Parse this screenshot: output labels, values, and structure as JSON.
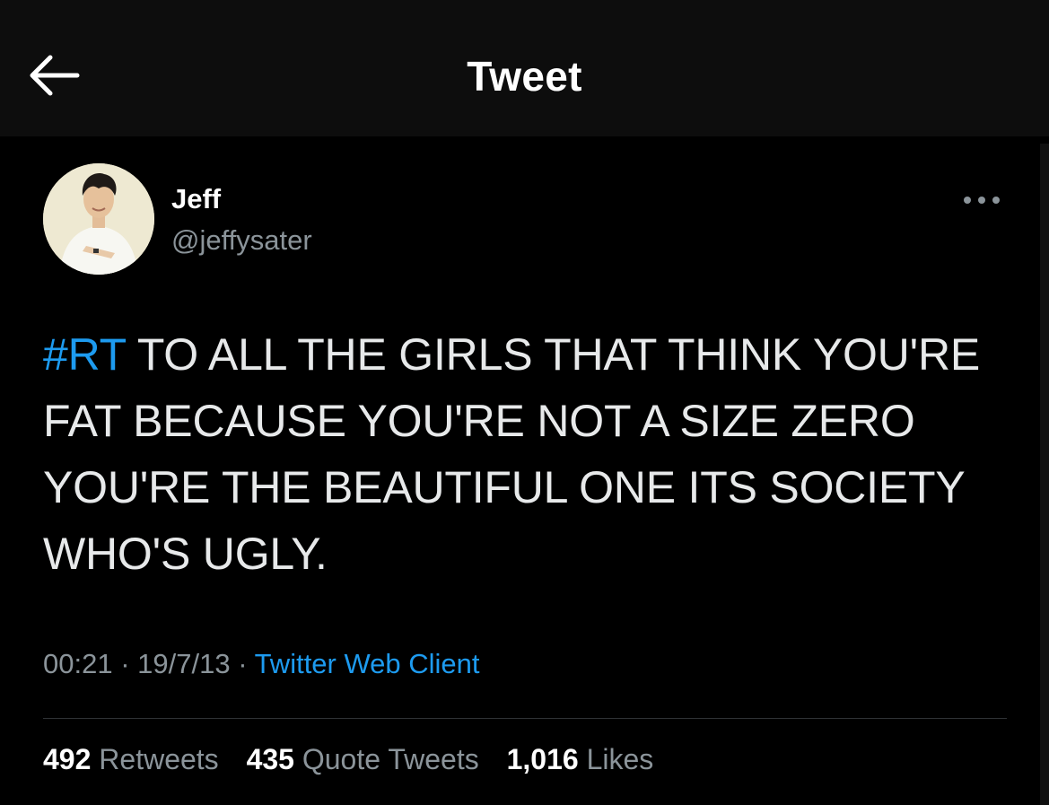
{
  "header": {
    "title": "Tweet",
    "back_icon": "arrow-left-icon"
  },
  "author": {
    "name": "Jeff",
    "handle": "@jeffysater",
    "avatar_icon": "profile-photo"
  },
  "more_icon": "ellipsis-icon",
  "tweet": {
    "hashtag": "#RT",
    "text_after_hashtag": " TO ALL THE GIRLS THAT THINK YOU'RE FAT BECAUSE YOU'RE NOT A SIZE ZERO YOU'RE THE BEAUTIFUL ONE ITS SOCIETY WHO'S UGLY."
  },
  "meta": {
    "time": "00:21",
    "date": "19/7/13",
    "separator": " · ",
    "client": "Twitter Web Client"
  },
  "stats": {
    "retweets_count": "492",
    "retweets_label": "Retweets",
    "quotes_count": "435",
    "quotes_label": "Quote Tweets",
    "likes_count": "1,016",
    "likes_label": "Likes"
  },
  "colors": {
    "background": "#000000",
    "header_bg": "#0d0d0d",
    "accent": "#1d9bf0",
    "secondary_text": "#8b949a",
    "primary_text": "#e7e9ea"
  }
}
